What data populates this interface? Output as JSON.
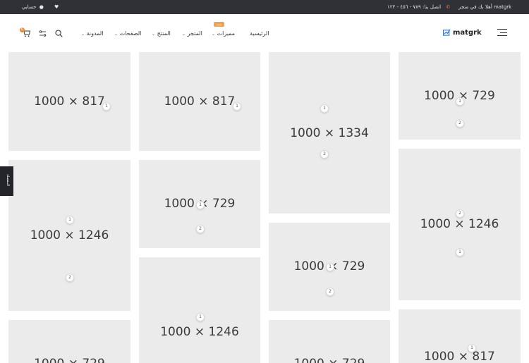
{
  "topbar": {
    "welcome": "أهلا بك في متجر matgrk",
    "contact": "اتصل بنا: ٧٨٩ - ٤٥٦ - ١٢٣",
    "account": "حسابي"
  },
  "header": {
    "logo": "matgrk",
    "nav": [
      {
        "label": "الرئيسية"
      },
      {
        "label": "مميزات",
        "badge": "جديد"
      },
      {
        "label": "المتجر"
      },
      {
        "label": "المنتج"
      },
      {
        "label": "الصفحات"
      },
      {
        "label": "المدونة"
      }
    ],
    "cart_count": "0"
  },
  "side_tab": "المفضلة",
  "gallery": [
    {
      "label": "1000 × 817",
      "dots": [
        "1"
      ]
    },
    {
      "label": "1000 × 817",
      "dots": [
        "1"
      ]
    },
    {
      "label": "1000 × 1334",
      "dots": [
        "1",
        "2"
      ]
    },
    {
      "label": "1000 × 729",
      "dots": [
        "1",
        "2"
      ]
    },
    {
      "label": "1000 × 1246",
      "dots": [
        "1",
        "2"
      ]
    },
    {
      "label": "1000 × 729",
      "dots": [
        "1",
        "2"
      ]
    },
    {
      "label": "1000 × 1246",
      "dots": [
        "2",
        "1"
      ]
    },
    {
      "label": "1000 × 1246",
      "dots": [
        "1"
      ]
    },
    {
      "label": "1000 × 729",
      "dots": [
        "1",
        "2"
      ]
    },
    {
      "label": "1000 × 729",
      "dots": []
    },
    {
      "label": "1000 × 729",
      "dots": []
    },
    {
      "label": "1000 × 817",
      "dots": [
        "1"
      ]
    }
  ]
}
